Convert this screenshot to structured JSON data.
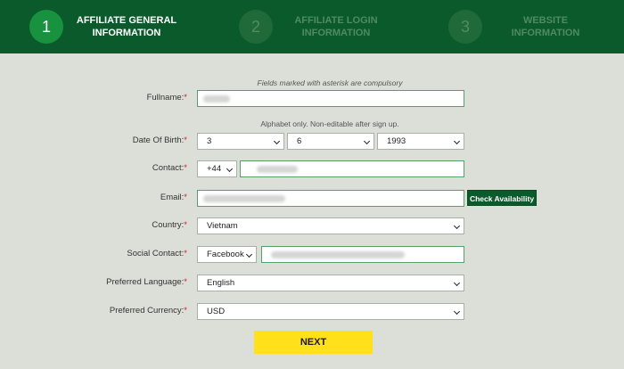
{
  "steps": [
    {
      "number": "1",
      "line1": "AFFILIATE GENERAL",
      "line2": "INFORMATION",
      "active": true
    },
    {
      "number": "2",
      "line1": "AFFILIATE LOGIN",
      "line2": "INFORMATION",
      "active": false
    },
    {
      "number": "3",
      "line1": "WEBSITE",
      "line2": "INFORMATION",
      "active": false
    }
  ],
  "notes": {
    "compulsory": "Fields marked with asterisk are compulsory",
    "alphabet": "Alphabet only. Non-editable after sign up."
  },
  "form": {
    "required_mark": "*",
    "fullname": {
      "label": "Fullname:"
    },
    "dob": {
      "label": "Date Of Birth:",
      "day": "3",
      "month": "6",
      "year": "1993"
    },
    "contact": {
      "label": "Contact:",
      "code": "+44"
    },
    "email": {
      "label": "Email:"
    },
    "country": {
      "label": "Country:",
      "value": "Vietnam"
    },
    "social": {
      "label": "Social Contact:",
      "platform": "Facebook"
    },
    "language": {
      "label": "Preferred Language:",
      "value": "English"
    },
    "currency": {
      "label": "Preferred Currency:",
      "value": "USD"
    }
  },
  "buttons": {
    "check_availability": "Check Availability",
    "next": "NEXT"
  },
  "colors": {
    "header_bg": "#0b5a2b",
    "active_step": "#18923f",
    "next_button": "#ffe01a",
    "required": "#d21f1f"
  },
  "icons": {
    "select_caret": "chevron-down-icon"
  }
}
